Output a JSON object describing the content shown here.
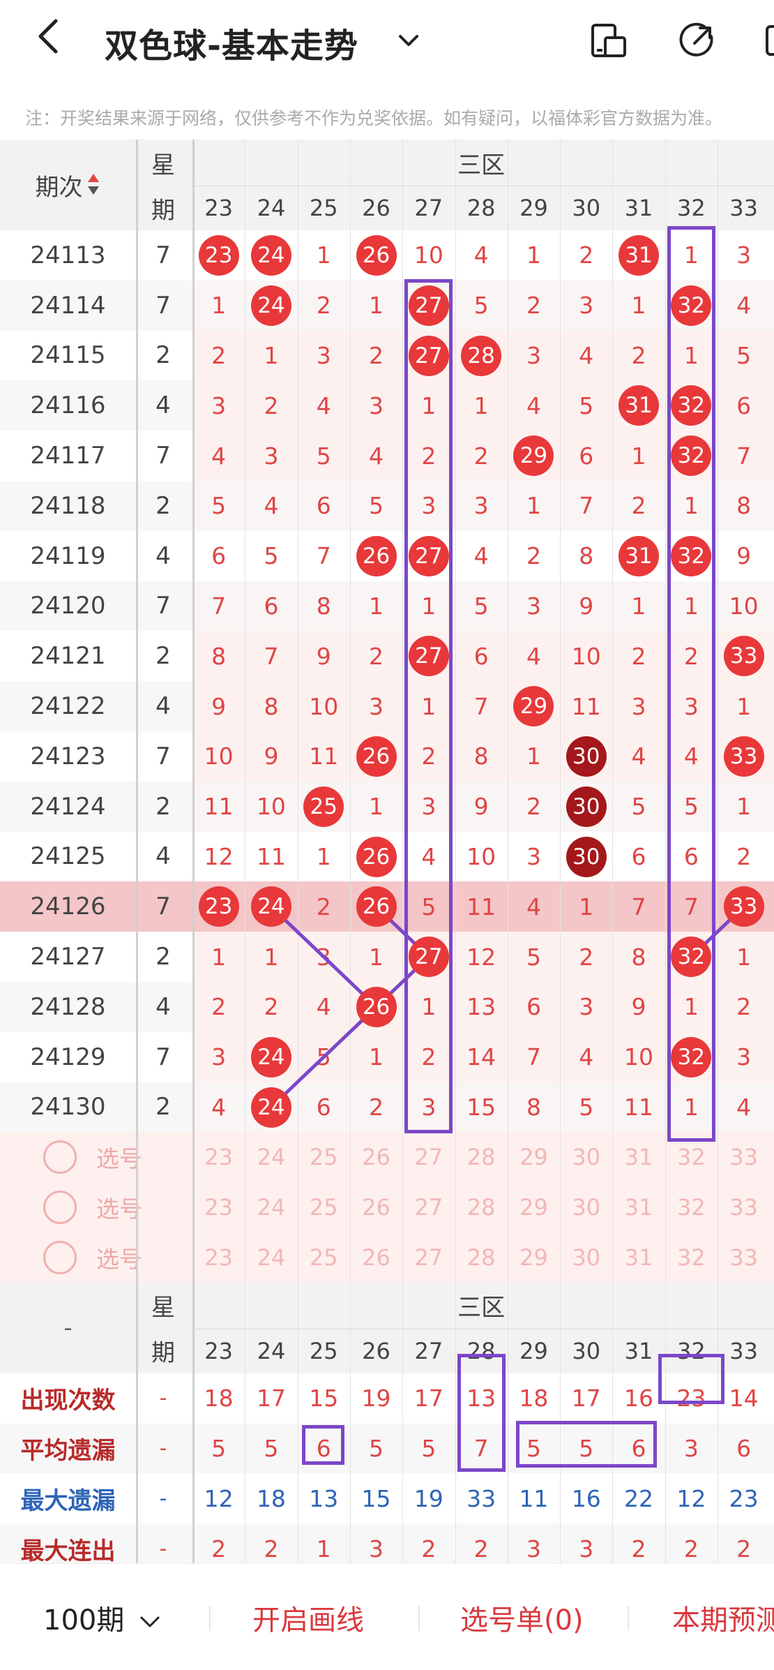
{
  "header": {
    "back_icon": "chevron-left-icon",
    "title": "双色球-基本走势",
    "title_dropdown_icon": "chevron-down-icon",
    "icons": [
      "device-toggle-icon",
      "share-icon",
      "more-icon"
    ]
  },
  "notice": "注：开奖结果来源于网络，仅供参考不作为兑奖依据。如有疑问，以福体彩官方数据为准。",
  "colors": {
    "ball_red": "#e8383a",
    "ball_dark": "#a4171b",
    "text_red": "#e04545",
    "text_blue": "#2e64b8",
    "highlight_row": "#f4c6c8",
    "pink_row": "#fdf0ee",
    "outline": "#7b47c9"
  },
  "table": {
    "period_header": "期次",
    "sort_icon": "sort-updown-icon",
    "weekday_header": [
      "星",
      "期"
    ],
    "zone_label": "三区",
    "columns": [
      "23",
      "24",
      "25",
      "26",
      "27",
      "28",
      "29",
      "30",
      "31",
      "32",
      "33"
    ],
    "rows": [
      {
        "period": "24113",
        "weekday": "7",
        "cells": [
          "23",
          "24",
          "1",
          "26",
          "10",
          "4",
          "1",
          "2",
          "31",
          "1",
          "3"
        ]
      },
      {
        "period": "24114",
        "weekday": "7",
        "cells": [
          "1",
          "24",
          "2",
          "1",
          "27",
          "5",
          "2",
          "3",
          "1",
          "32",
          "4"
        ]
      },
      {
        "period": "24115",
        "weekday": "2",
        "cells": [
          "2",
          "1",
          "3",
          "2",
          "27",
          "28",
          "3",
          "4",
          "2",
          "1",
          "5"
        ]
      },
      {
        "period": "24116",
        "weekday": "4",
        "cells": [
          "3",
          "2",
          "4",
          "3",
          "1",
          "1",
          "4",
          "5",
          "31",
          "32",
          "6"
        ]
      },
      {
        "period": "24117",
        "weekday": "7",
        "cells": [
          "4",
          "3",
          "5",
          "4",
          "2",
          "2",
          "29",
          "6",
          "1",
          "32",
          "7"
        ]
      },
      {
        "period": "24118",
        "weekday": "2",
        "cells": [
          "5",
          "4",
          "6",
          "5",
          "3",
          "3",
          "1",
          "7",
          "2",
          "1",
          "8"
        ]
      },
      {
        "period": "24119",
        "weekday": "4",
        "cells": [
          "6",
          "5",
          "7",
          "26",
          "27",
          "4",
          "2",
          "8",
          "31",
          "32",
          "9"
        ]
      },
      {
        "period": "24120",
        "weekday": "7",
        "cells": [
          "7",
          "6",
          "8",
          "1",
          "1",
          "5",
          "3",
          "9",
          "1",
          "1",
          "10"
        ]
      },
      {
        "period": "24121",
        "weekday": "2",
        "cells": [
          "8",
          "7",
          "9",
          "2",
          "27",
          "6",
          "4",
          "10",
          "2",
          "2",
          "33"
        ]
      },
      {
        "period": "24122",
        "weekday": "4",
        "cells": [
          "9",
          "8",
          "10",
          "3",
          "1",
          "7",
          "29",
          "11",
          "3",
          "3",
          "1"
        ]
      },
      {
        "period": "24123",
        "weekday": "7",
        "cells": [
          "10",
          "9",
          "11",
          "26",
          "2",
          "8",
          "1",
          "30",
          "4",
          "4",
          "33"
        ]
      },
      {
        "period": "24124",
        "weekday": "2",
        "cells": [
          "11",
          "10",
          "25",
          "1",
          "3",
          "9",
          "2",
          "30",
          "5",
          "5",
          "1"
        ]
      },
      {
        "period": "24125",
        "weekday": "4",
        "cells": [
          "12",
          "11",
          "1",
          "26",
          "4",
          "10",
          "3",
          "30",
          "6",
          "6",
          "2"
        ]
      },
      {
        "period": "24126",
        "weekday": "7",
        "cells": [
          "23",
          "24",
          "2",
          "26",
          "5",
          "11",
          "4",
          "1",
          "7",
          "7",
          "33"
        ]
      },
      {
        "period": "24127",
        "weekday": "2",
        "cells": [
          "1",
          "1",
          "3",
          "1",
          "27",
          "12",
          "5",
          "2",
          "8",
          "32",
          "1"
        ]
      },
      {
        "period": "24128",
        "weekday": "4",
        "cells": [
          "2",
          "2",
          "4",
          "26",
          "1",
          "13",
          "6",
          "3",
          "9",
          "1",
          "2"
        ]
      },
      {
        "period": "24129",
        "weekday": "7",
        "cells": [
          "3",
          "24",
          "5",
          "1",
          "2",
          "14",
          "7",
          "4",
          "10",
          "32",
          "3"
        ]
      },
      {
        "period": "24130",
        "weekday": "2",
        "cells": [
          "4",
          "24",
          "6",
          "2",
          "3",
          "15",
          "8",
          "5",
          "11",
          "1",
          "4"
        ]
      }
    ],
    "select_rows": [
      {
        "label": "选号",
        "numbers": [
          "23",
          "24",
          "25",
          "26",
          "27",
          "28",
          "29",
          "30",
          "31",
          "32",
          "33"
        ]
      },
      {
        "label": "选号",
        "numbers": [
          "23",
          "24",
          "25",
          "26",
          "27",
          "28",
          "29",
          "30",
          "31",
          "32",
          "33"
        ]
      },
      {
        "label": "选号",
        "numbers": [
          "23",
          "24",
          "25",
          "26",
          "27",
          "28",
          "29",
          "30",
          "31",
          "32",
          "33"
        ]
      }
    ],
    "stats_dash": "-",
    "stats": [
      {
        "label": "出现次数",
        "value": "-",
        "color": "red",
        "cells": [
          "18",
          "17",
          "15",
          "19",
          "17",
          "13",
          "18",
          "17",
          "16",
          "23",
          "14"
        ]
      },
      {
        "label": "平均遗漏",
        "value": "-",
        "color": "red",
        "cells": [
          "5",
          "5",
          "6",
          "5",
          "5",
          "7",
          "5",
          "5",
          "6",
          "3",
          "6"
        ]
      },
      {
        "label": "最大遗漏",
        "value": "-",
        "color": "blue",
        "cells": [
          "12",
          "18",
          "13",
          "15",
          "19",
          "33",
          "11",
          "16",
          "22",
          "12",
          "23"
        ]
      },
      {
        "label": "最大连出",
        "value": "-",
        "color": "red",
        "cells": [
          "2",
          "2",
          "1",
          "3",
          "2",
          "2",
          "3",
          "3",
          "2",
          "2",
          "2"
        ]
      }
    ]
  },
  "bottom_bar": {
    "period_selector": "100期",
    "period_chevron_icon": "chevron-down-icon",
    "draw_line": "开启画线",
    "pick_list": "选号单(0)",
    "forecast": "本期预测"
  }
}
